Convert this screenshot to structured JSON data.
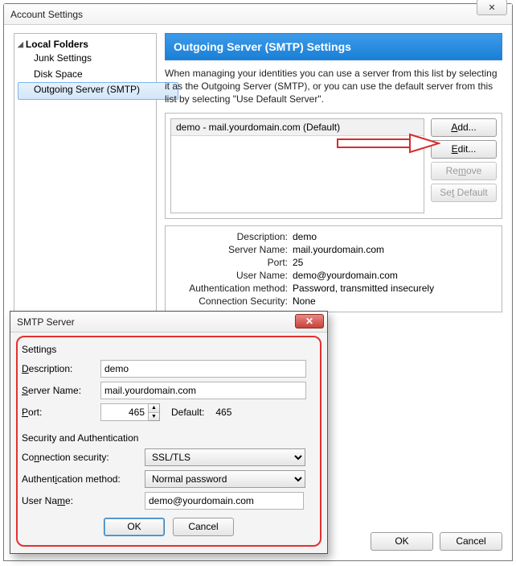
{
  "mainWindow": {
    "title": "Account Settings",
    "closeGlyph": "✕"
  },
  "sidebar": {
    "root": "Local Folders",
    "items": [
      "Junk Settings",
      "Disk Space",
      "Outgoing Server (SMTP)"
    ],
    "selectedIndex": 2
  },
  "header": "Outgoing Server (SMTP) Settings",
  "description": "When managing your identities you can use a server from this list by selecting it as the Outgoing Server (SMTP), or you can use the default server from this list by selecting \"Use Default Server\".",
  "serverList": {
    "rows": [
      "demo - mail.yourdomain.com (Default)"
    ]
  },
  "buttons": {
    "add": "Add...",
    "edit": "Edit...",
    "remove": "Remove",
    "setDefault": "Set Default",
    "ok": "OK",
    "cancel": "Cancel"
  },
  "details": {
    "labels": {
      "description": "Description:",
      "serverName": "Server Name:",
      "port": "Port:",
      "userName": "User Name:",
      "authMethod": "Authentication method:",
      "connSecurity": "Connection Security:"
    },
    "values": {
      "description": "demo",
      "serverName": "mail.yourdomain.com",
      "port": "25",
      "userName": "demo@yourdomain.com",
      "authMethod": "Password, transmitted insecurely",
      "connSecurity": "None"
    }
  },
  "dialog": {
    "title": "SMTP Server",
    "closeGlyph": "✕",
    "section1": "Settings",
    "section2": "Security and Authentication",
    "fields": {
      "descriptionLabel": "Description:",
      "descriptionValue": "demo",
      "serverNameLabel": "Server Name:",
      "serverNameValue": "mail.yourdomain.com",
      "portLabel": "Port:",
      "portValue": "465",
      "defaultLabel": "Default:",
      "defaultValue": "465",
      "connSecLabel": "Connection security:",
      "connSecValue": "SSL/TLS",
      "authLabel": "Authentication method:",
      "authValue": "Normal password",
      "userLabel": "User Name:",
      "userValue": "demo@yourdomain.com"
    },
    "ok": "OK",
    "cancel": "Cancel"
  }
}
